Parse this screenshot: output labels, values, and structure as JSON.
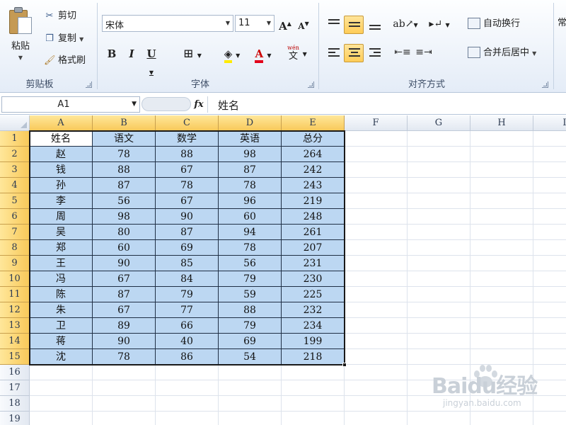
{
  "ribbon": {
    "clipboard": {
      "paste_label": "粘贴",
      "cut_label": "剪切",
      "copy_label": "复制",
      "format_painter_label": "格式刷",
      "group_label": "剪贴板"
    },
    "font": {
      "font_name": "宋体",
      "font_size": "11",
      "grow_label": "A",
      "shrink_label": "A",
      "bold_label": "B",
      "italic_label": "I",
      "underline_label": "U",
      "font_color_label": "A",
      "phonetic_label": "wén",
      "phonetic_char": "文",
      "group_label": "字体"
    },
    "alignment": {
      "wrap_text_label": "自动换行",
      "merge_center_label": "合并后居中",
      "group_label": "对齐方式"
    },
    "partial_next_group_label": "常"
  },
  "formula_bar": {
    "name_box": "A1",
    "fx_label": "fx",
    "formula": "姓名"
  },
  "sheet": {
    "columns": [
      "A",
      "B",
      "C",
      "D",
      "E",
      "F",
      "G",
      "H",
      "I"
    ],
    "rows": [
      "1",
      "2",
      "3",
      "4",
      "5",
      "6",
      "7",
      "8",
      "9",
      "10",
      "11",
      "12",
      "13",
      "14",
      "15",
      "16",
      "17",
      "18",
      "19"
    ],
    "table": [
      [
        "姓名",
        "语文",
        "数学",
        "英语",
        "总分"
      ],
      [
        "赵",
        "78",
        "88",
        "98",
        "264"
      ],
      [
        "钱",
        "88",
        "67",
        "87",
        "242"
      ],
      [
        "孙",
        "87",
        "78",
        "78",
        "243"
      ],
      [
        "李",
        "56",
        "67",
        "96",
        "219"
      ],
      [
        "周",
        "98",
        "90",
        "60",
        "248"
      ],
      [
        "吴",
        "80",
        "87",
        "94",
        "261"
      ],
      [
        "郑",
        "60",
        "69",
        "78",
        "207"
      ],
      [
        "王",
        "90",
        "85",
        "56",
        "231"
      ],
      [
        "冯",
        "67",
        "84",
        "79",
        "230"
      ],
      [
        "陈",
        "87",
        "79",
        "59",
        "225"
      ],
      [
        "朱",
        "67",
        "77",
        "88",
        "232"
      ],
      [
        "卫",
        "89",
        "66",
        "79",
        "234"
      ],
      [
        "蒋",
        "90",
        "40",
        "69",
        "199"
      ],
      [
        "沈",
        "78",
        "86",
        "54",
        "218"
      ]
    ],
    "selected_range": "A1:E15",
    "active_cell": "A1"
  },
  "watermark": {
    "brand": "Baidu经验",
    "url": "jingyan.baidu.com"
  },
  "colors": {
    "selection_fill": "#bcd7f2",
    "header_highlight": "#f8c95a"
  }
}
